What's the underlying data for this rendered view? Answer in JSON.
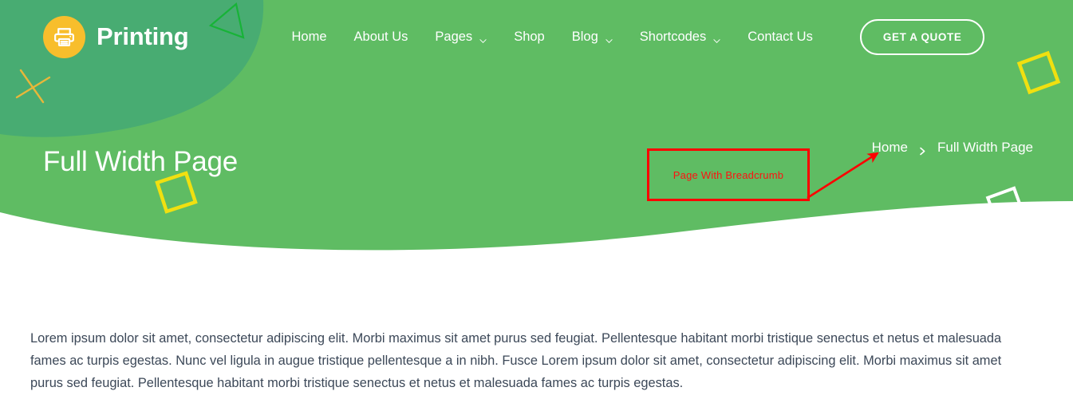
{
  "brand": {
    "name": "Printing",
    "logo_icon": "printer-icon",
    "logo_bg": "#F8BE2C"
  },
  "nav": {
    "items": [
      {
        "label": "Home",
        "has_dropdown": false
      },
      {
        "label": "About Us",
        "has_dropdown": false
      },
      {
        "label": "Pages",
        "has_dropdown": true
      },
      {
        "label": "Shop",
        "has_dropdown": false
      },
      {
        "label": "Blog",
        "has_dropdown": true
      },
      {
        "label": "Shortcodes",
        "has_dropdown": true
      },
      {
        "label": "Contact Us",
        "has_dropdown": false
      }
    ],
    "cta_label": "GET A QUOTE"
  },
  "hero": {
    "title": "Full Width Page",
    "breadcrumb": {
      "home_label": "Home",
      "separator": "›",
      "current_label": "Full Width Page"
    }
  },
  "annotation": {
    "label": "Page With Breadcrumb",
    "color": "#FF0000"
  },
  "content": {
    "paragraph": "Lorem ipsum dolor sit amet, consectetur adipiscing elit. Morbi maximus sit amet purus sed feugiat. Pellentesque habitant morbi tristique senectus et netus et malesuada fames ac turpis egestas. Nunc vel ligula in augue tristique pellentesque a in nibh. Fusce Lorem ipsum dolor sit amet, consectetur adipiscing elit. Morbi maximus sit amet purus sed feugiat. Pellentesque habitant morbi tristique senectus et netus et malesuada fames ac turpis egestas."
  },
  "colors": {
    "hero_green": "#5FBC63",
    "hero_green_dark": "#48AC72",
    "accent_yellow": "#F0E010",
    "logo_yellow": "#F8BE2C",
    "triangle_green": "#17B337",
    "cross_gold": "#E8B73A",
    "white": "#FFFFFF",
    "body_text": "#3C4858"
  },
  "decor": [
    {
      "name": "triangle-outline",
      "color": "#17B337"
    },
    {
      "name": "cross-mark",
      "color": "#E8B73A"
    },
    {
      "name": "diamond-yellow-left",
      "color": "#F0E010"
    },
    {
      "name": "diamond-yellow-right",
      "color": "#F0E010"
    },
    {
      "name": "diamond-white",
      "color": "#FFFFFF"
    }
  ]
}
